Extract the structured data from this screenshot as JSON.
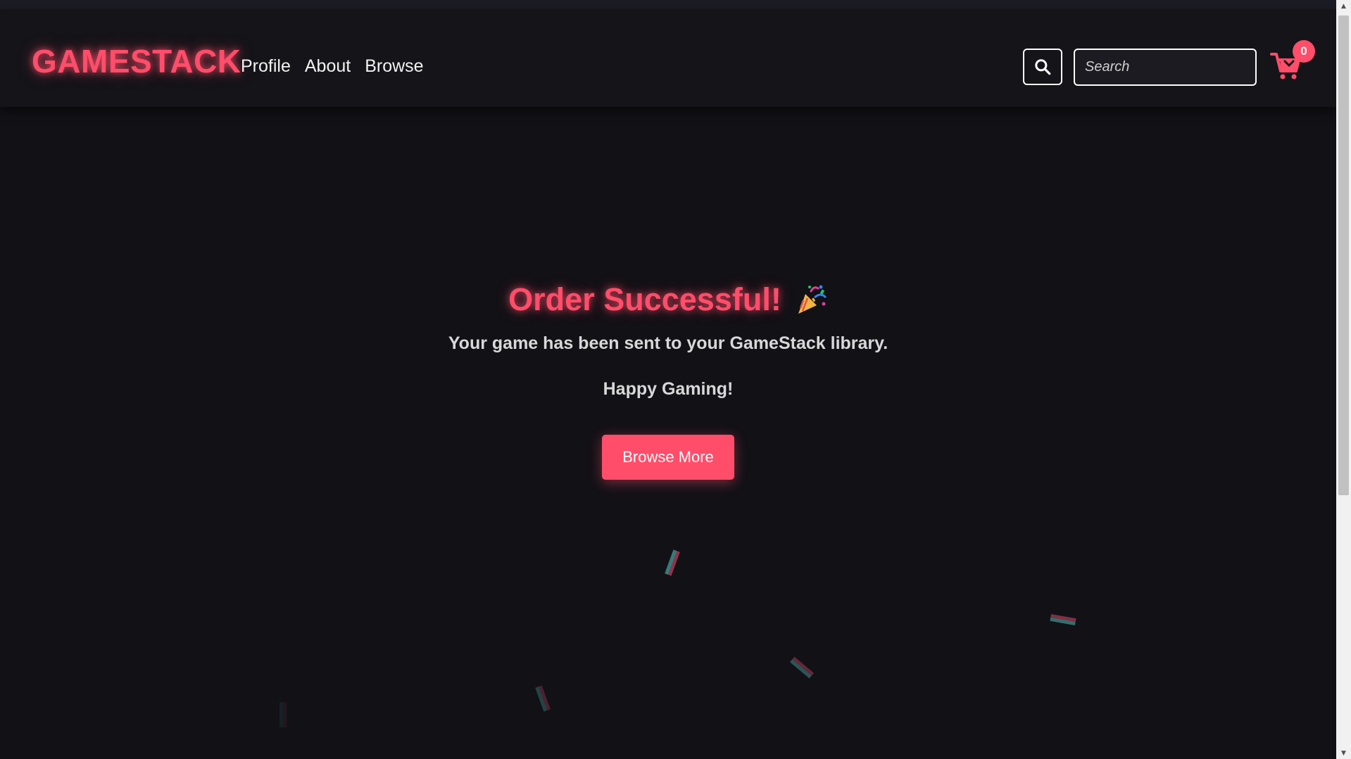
{
  "navbar": {
    "brand": "GAMESTACK",
    "links": [
      "Profile",
      "About",
      "Browse"
    ],
    "search": {
      "placeholder": "Search",
      "value": ""
    },
    "search_icon": "search-icon",
    "cart_icon": "cart-icon",
    "cart_count": "0"
  },
  "main": {
    "title": "Order Successful!",
    "title_icon": "party-popper-icon",
    "message": "Your game has been sent to your GameStack library.",
    "message_2": "Happy Gaming!",
    "cta_label": "Browse More"
  },
  "colors": {
    "accent": "#ff4d6a",
    "background": "#121116",
    "navbar": "#141419",
    "text": "#d8d8d8"
  }
}
